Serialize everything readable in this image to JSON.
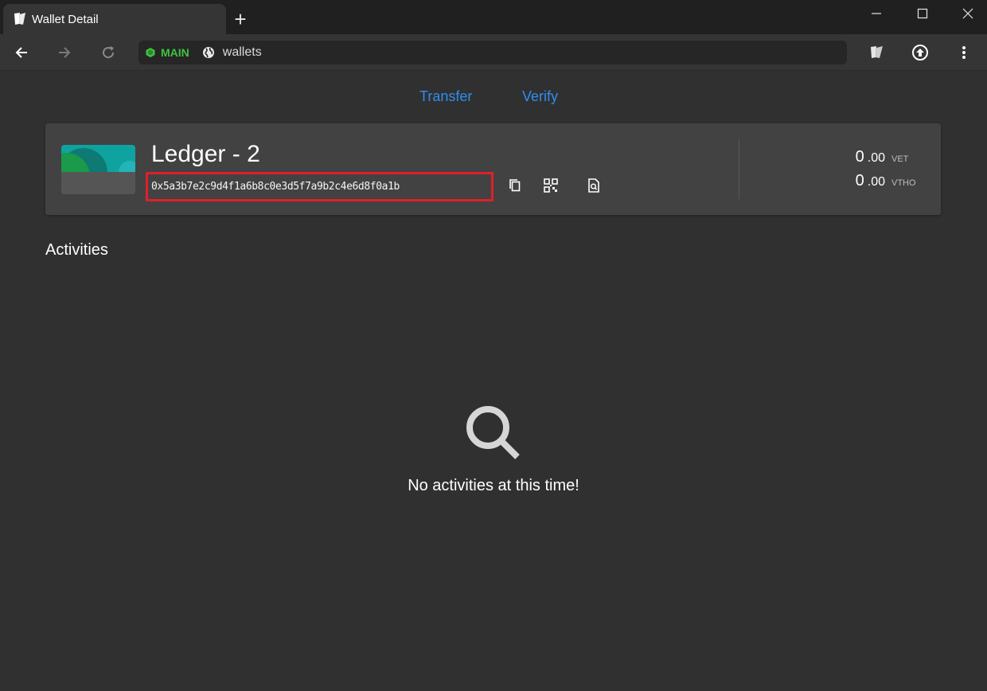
{
  "browser": {
    "tab_title": "Wallet Detail",
    "new_tab_glyph": "+",
    "network_label": "MAIN",
    "url": "wallets",
    "icons": [
      "sync-logo-icon",
      "back-icon",
      "forward-icon",
      "reload-icon",
      "globe-icon",
      "upload-icon",
      "more-vert-icon",
      "minimize-icon",
      "maximize-icon",
      "close-icon"
    ]
  },
  "nav": {
    "transfer_label": "Transfer",
    "verify_label": "Verify"
  },
  "wallet": {
    "name": "Ledger - 2",
    "address": "0x5a3b7e2c9d4f1a6b8c0e3d5f7a9b2c4e6d8f0a1b",
    "address_redacted": true,
    "balances": [
      {
        "int": "0",
        "dec": ".00",
        "unit": "VET"
      },
      {
        "int": "0",
        "dec": ".00",
        "unit": "VTHO"
      }
    ]
  },
  "activities": {
    "title": "Activities",
    "empty_message": "No activities at this time!"
  },
  "colors": {
    "accent_link": "#2f8df0",
    "network_green": "#3fc33f",
    "highlight_red": "#e0202a",
    "background": "#303030",
    "card": "#424242"
  }
}
